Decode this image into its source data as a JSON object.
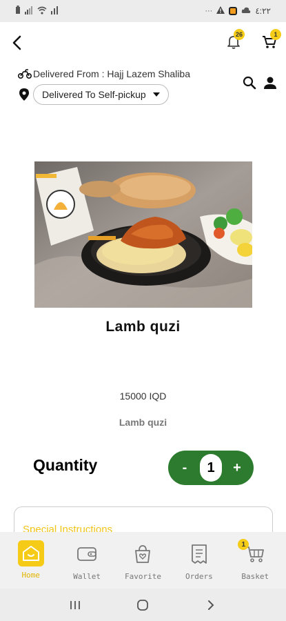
{
  "status_bar": {
    "time": "٤:٢٢"
  },
  "app_bar": {
    "notification_count": "26",
    "cart_count": "1"
  },
  "delivery": {
    "from_text": "Delivered From : Hajj Lazem Shaliba",
    "to_text": "Delivered To Self-pickup"
  },
  "product": {
    "title": "Lamb quzi",
    "price": "15000 IQD",
    "subtitle": "Lamb quzi"
  },
  "quantity": {
    "label": "Quantity",
    "minus": "-",
    "value": "1",
    "plus": "+"
  },
  "instructions": {
    "label": "Special Instructions"
  },
  "bottom_nav": {
    "items": [
      {
        "label": "Home",
        "icon": "home-icon",
        "active": true
      },
      {
        "label": "Wallet",
        "icon": "wallet-icon"
      },
      {
        "label": "Favorite",
        "icon": "favorite-bag-icon"
      },
      {
        "label": "Orders",
        "icon": "orders-receipt-icon"
      },
      {
        "label": "Basket",
        "icon": "basket-cart-icon",
        "badge": "1"
      }
    ]
  },
  "colors": {
    "accent_yellow": "#f6cb18",
    "stepper_green": "#2c7b2e",
    "instructions_label": "#f0c419"
  }
}
